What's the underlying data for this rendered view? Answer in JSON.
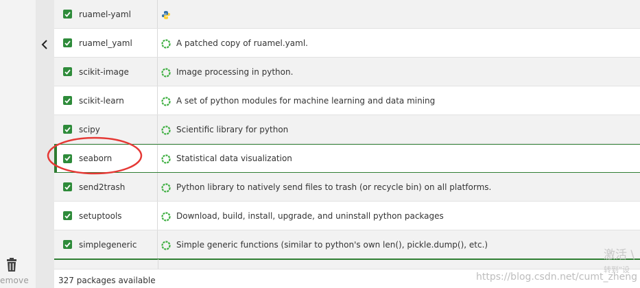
{
  "packages": [
    {
      "name": "ruamel-yaml",
      "description": "",
      "icon": "python-logo-icon"
    },
    {
      "name": "ruamel_yaml",
      "description": "A patched copy of ruamel.yaml.",
      "icon": "status-ring-icon"
    },
    {
      "name": "scikit-image",
      "description": "Image processing in python.",
      "icon": "status-ring-icon"
    },
    {
      "name": "scikit-learn",
      "description": "A set of python modules for machine learning and data mining",
      "icon": "status-ring-icon"
    },
    {
      "name": "scipy",
      "description": "Scientific library for python",
      "icon": "status-ring-icon"
    },
    {
      "name": "seaborn",
      "description": "Statistical data visualization",
      "icon": "status-ring-icon"
    },
    {
      "name": "send2trash",
      "description": "Python library to natively send files to trash (or recycle bin) on all platforms.",
      "icon": "status-ring-icon"
    },
    {
      "name": "setuptools",
      "description": "Download, build, install, upgrade, and uninstall python packages",
      "icon": "status-ring-icon"
    },
    {
      "name": "simplegeneric",
      "description": "Simple generic functions (similar to python's own len(), pickle.dump(), etc.)",
      "icon": "status-ring-icon"
    }
  ],
  "selected_package": "seaborn",
  "footer": {
    "count_text": "327 packages available"
  },
  "sidebar": {
    "remove_label": "emove"
  },
  "watermark": {
    "line1": "激活 \\",
    "line2": "转到\"设",
    "url": "https://blog.csdn.net/cumt_zheng"
  },
  "colors": {
    "accent": "#2e8b3a",
    "selected_border": "#2e7d32",
    "annotation": "#e53935"
  }
}
